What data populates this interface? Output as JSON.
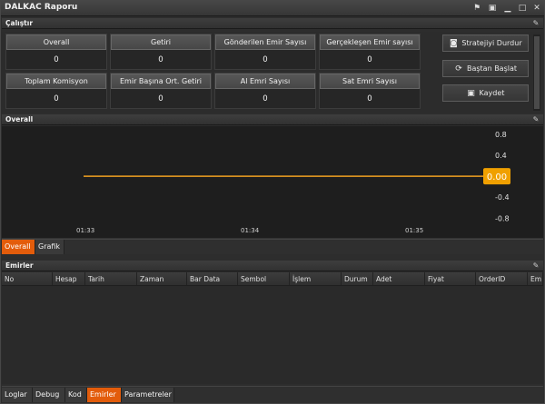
{
  "window": {
    "title": "DALKAC Raporu"
  },
  "run_section": {
    "title": "Çalıştır"
  },
  "metrics": [
    {
      "label": "Overall",
      "value": "0"
    },
    {
      "label": "Getiri",
      "value": "0"
    },
    {
      "label": "Gönderilen Emir Sayısı",
      "value": "0"
    },
    {
      "label": "Gerçekleşen Emir sayısı",
      "value": "0"
    },
    {
      "label": "Toplam Komisyon",
      "value": "0"
    },
    {
      "label": "Emir Başına Ort. Getiri",
      "value": "0"
    },
    {
      "label": "Al Emri Sayısı",
      "value": "0"
    },
    {
      "label": "Sat Emri Sayısı",
      "value": "0"
    }
  ],
  "actions": {
    "stop": "Stratejiyi Durdur",
    "restart": "Baştan Başlat",
    "save": "Kaydet"
  },
  "overall_section": {
    "title": "Overall"
  },
  "chart_data": {
    "type": "line",
    "x": [
      "01:33",
      "01:35"
    ],
    "x_ticks": [
      "01:33",
      "01:34",
      "01:35"
    ],
    "series": [
      {
        "values": [
          0.0,
          0.0
        ],
        "color": "#f0a020"
      }
    ],
    "y_ticks": [
      "0.8",
      "0.4",
      "-0.4",
      "-0.8"
    ],
    "ylim": [
      -0.9,
      0.9
    ],
    "last_value_label": "0.00",
    "grid": false
  },
  "chart_tabs": [
    {
      "label": "Overall",
      "active": true
    },
    {
      "label": "Grafik",
      "active": false
    }
  ],
  "orders_section": {
    "title": "Emirler"
  },
  "order_columns": [
    "No",
    "Hesap",
    "Tarih",
    "Zaman",
    "Bar Data",
    "Sembol",
    "İşlem",
    "Durum",
    "Adet",
    "Fiyat",
    "OrderID",
    "Em"
  ],
  "bottom_tabs": [
    {
      "label": "Loglar",
      "active": false
    },
    {
      "label": "Debug",
      "active": false
    },
    {
      "label": "Kod",
      "active": false
    },
    {
      "label": "Emirler",
      "active": true
    },
    {
      "label": "Parametreler",
      "active": false
    }
  ],
  "colors": {
    "accent": "#e35c0b",
    "series": "#f0a020",
    "value_label_bg": "#f0a000"
  }
}
